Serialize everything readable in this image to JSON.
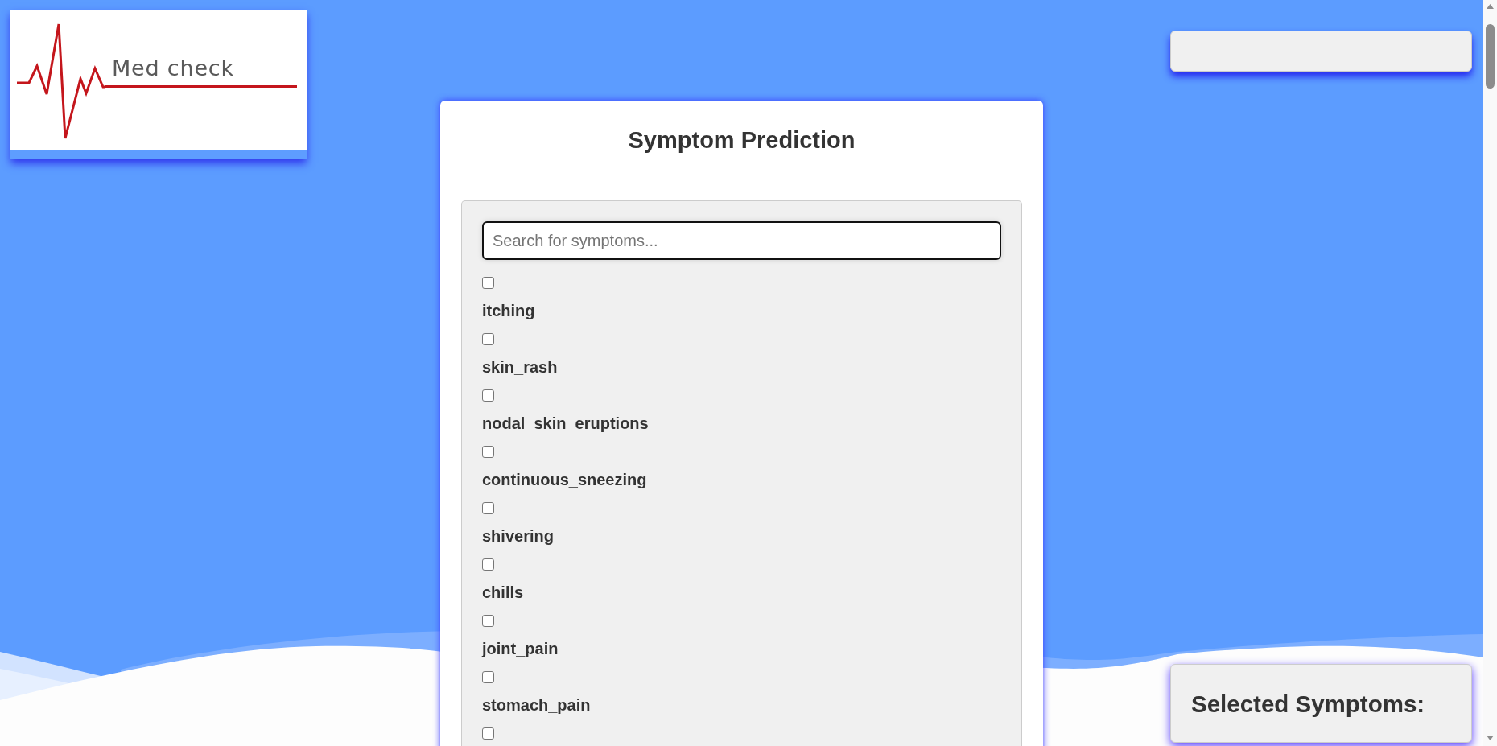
{
  "logo": {
    "text": "Med check"
  },
  "card": {
    "title": "Symptom Prediction",
    "search": {
      "placeholder": "Search for symptoms..."
    },
    "symptoms": [
      {
        "label": "itching",
        "checked": false
      },
      {
        "label": "skin_rash",
        "checked": false
      },
      {
        "label": "nodal_skin_eruptions",
        "checked": false
      },
      {
        "label": "continuous_sneezing",
        "checked": false
      },
      {
        "label": "shivering",
        "checked": false
      },
      {
        "label": "chills",
        "checked": false
      },
      {
        "label": "joint_pain",
        "checked": false
      },
      {
        "label": "stomach_pain",
        "checked": false
      },
      {
        "checked": false
      }
    ]
  },
  "selected_panel": {
    "title": "Selected Symptoms:"
  }
}
